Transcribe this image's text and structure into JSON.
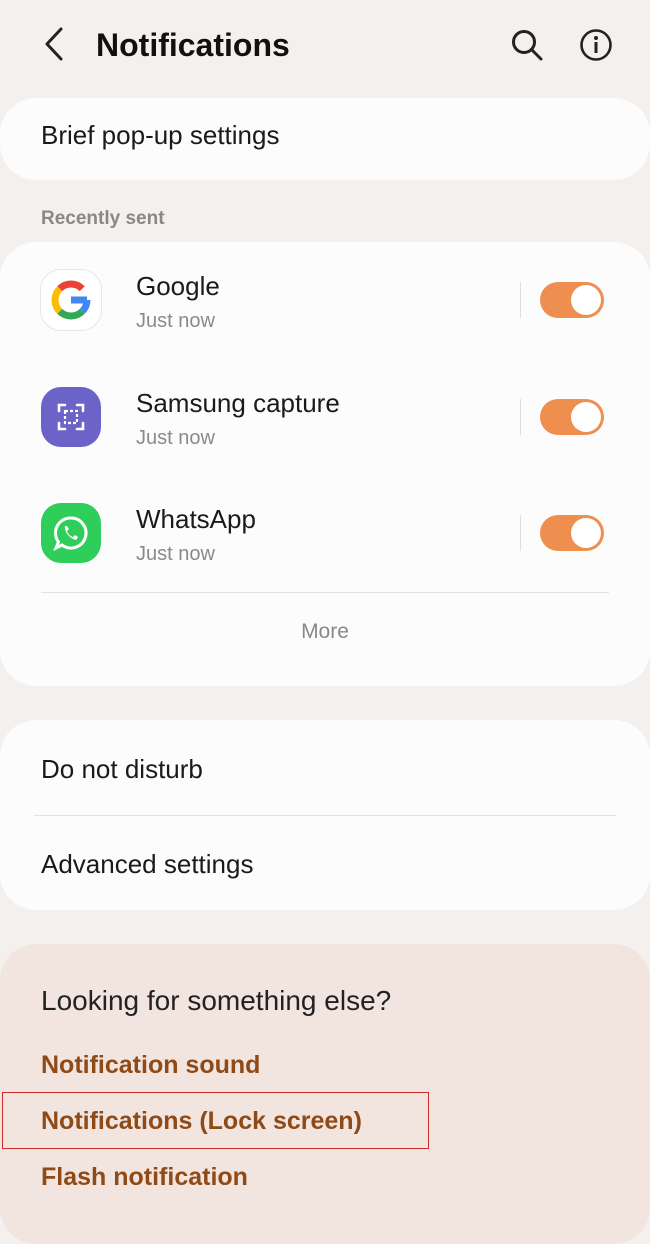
{
  "header": {
    "title": "Notifications",
    "back_icon": "chevron-left-icon",
    "search_icon": "search-icon",
    "info_icon": "info-icon"
  },
  "brief_popup": {
    "label": "Brief pop-up settings"
  },
  "recently_sent": {
    "section_label": "Recently sent",
    "apps": [
      {
        "name": "Google",
        "time": "Just now",
        "icon": "google-icon",
        "enabled": true
      },
      {
        "name": "Samsung capture",
        "time": "Just now",
        "icon": "samsung-capture-icon",
        "enabled": true
      },
      {
        "name": "WhatsApp",
        "time": "Just now",
        "icon": "whatsapp-icon",
        "enabled": true
      }
    ],
    "more_label": "More"
  },
  "settings": {
    "do_not_disturb": "Do not disturb",
    "advanced": "Advanced settings"
  },
  "looking_for": {
    "title": "Looking for something else?",
    "links": [
      "Notification sound",
      "Notifications (Lock screen)",
      "Flash notification"
    ]
  },
  "colors": {
    "toggle_on": "#ee8f4f",
    "link": "#8e4a17",
    "highlight": "#c9302c",
    "background": "#f4f0ee"
  }
}
